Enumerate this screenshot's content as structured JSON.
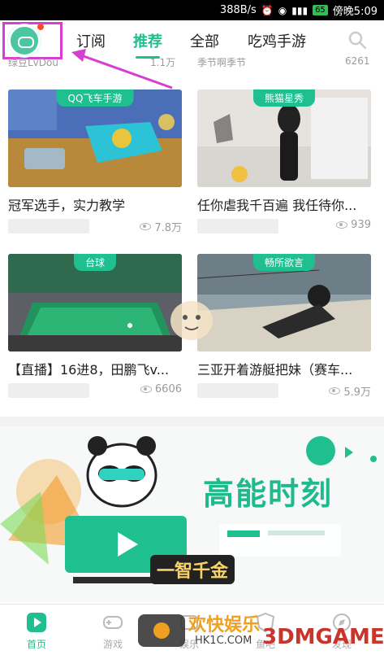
{
  "status_bar": {
    "net_speed": "388B/s",
    "battery": "65",
    "time": "傍晚5:09"
  },
  "top_nav": {
    "tabs": [
      {
        "label": "订阅",
        "active": false
      },
      {
        "label": "推荐",
        "active": true
      },
      {
        "label": "全部",
        "active": false
      },
      {
        "label": "吃鸡手游",
        "active": false
      }
    ]
  },
  "prev_row": {
    "left_author": "绿豆LvDou",
    "left_views": "1.1万",
    "right_author": "季节啊季节",
    "right_views": "6261"
  },
  "cards": [
    {
      "category": "QQ飞车手游",
      "title": "冠军选手，实力教学",
      "views": "7.8万"
    },
    {
      "category": "熊猫星秀",
      "title": "任你虐我千百遍 我任待你...",
      "views": "939"
    },
    {
      "category": "台球",
      "title": "【直播】16进8，田鹏飞v...",
      "views": "6606"
    },
    {
      "category": "畅所欲言",
      "title": "三亚开着游艇把妹（赛车...",
      "views": "5.9万"
    }
  ],
  "banner": {
    "headline": "高能时刻",
    "badge": "一智千金"
  },
  "bottom_nav": [
    {
      "label": "首页",
      "active": true
    },
    {
      "label": "游戏",
      "active": false
    },
    {
      "label": "娱乐",
      "active": false
    },
    {
      "label": "鱼吧",
      "active": false
    },
    {
      "label": "发现",
      "active": false
    }
  ],
  "watermark": {
    "line1": "欢快娱乐",
    "line2": "HK1C.COM",
    "brand": "3DMGAME"
  },
  "colors": {
    "accent": "#1fbf8f",
    "highlight": "#d63fd0",
    "dot": "#ff4a2a"
  }
}
